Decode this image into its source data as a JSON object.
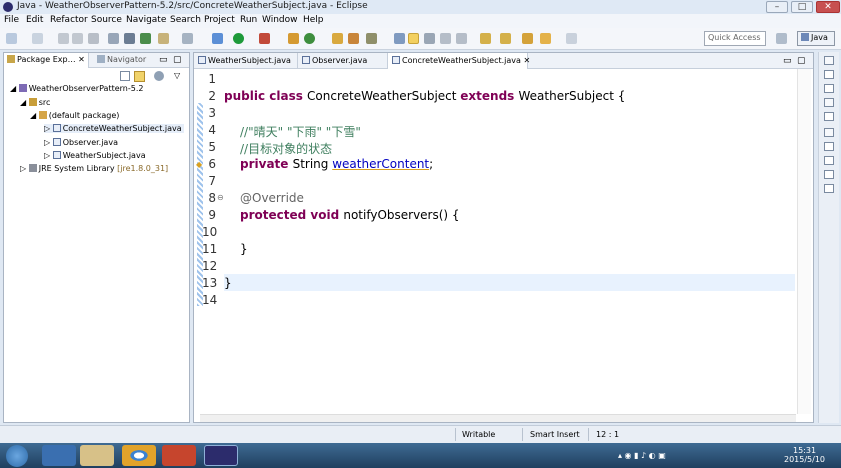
{
  "window": {
    "title": "Java - WeatherObserverPattern-5.2/src/ConcreteWeatherSubject.java - Eclipse",
    "minimize": "–",
    "maximize": "□",
    "close": "✕"
  },
  "menu": [
    "File",
    "Edit",
    "Refactor",
    "Source",
    "Navigate",
    "Search",
    "Project",
    "Run",
    "Window",
    "Help"
  ],
  "toolbar": {
    "quick_access_placeholder": "Quick Access",
    "perspective_label": "Java"
  },
  "package_explorer": {
    "tab_label": "Package Exp…",
    "navigator_label": "Navigator",
    "tree": [
      {
        "label": "WeatherObserverPattern-5.2",
        "indent": 0,
        "icon": "project-icon"
      },
      {
        "label": "src",
        "indent": 1,
        "icon": "source-folder-icon"
      },
      {
        "label": "(default package)",
        "indent": 2,
        "icon": "package-icon"
      },
      {
        "label": "ConcreteWeatherSubject.java",
        "indent": 3,
        "icon": "java-file-icon"
      },
      {
        "label": "Observer.java",
        "indent": 3,
        "icon": "java-file-icon"
      },
      {
        "label": "WeatherSubject.java",
        "indent": 3,
        "icon": "java-file-icon"
      },
      {
        "label": "JRE System Library",
        "suffix": "[jre1.8.0_31]",
        "indent": 1,
        "icon": "library-icon"
      }
    ]
  },
  "editor": {
    "tabs": [
      {
        "label": "WeatherSubject.java",
        "active": false
      },
      {
        "label": "Observer.java",
        "active": false
      },
      {
        "label": "ConcreteWeatherSubject.java",
        "active": true
      }
    ],
    "line_numbers": [
      "1",
      "2",
      "3",
      "4",
      "5",
      "6",
      "7",
      "8",
      "9",
      "10",
      "11",
      "12",
      "13",
      "14"
    ],
    "code": {
      "l2_kw": "public class ",
      "l2_name": "ConcreteWeatherSubject ",
      "l2_ext": "extends ",
      "l2_super": "WeatherSubject {",
      "l4": "//\"晴天\" \"下雨\" \"下雪\"",
      "l5": "//目标对象的状态",
      "l6_kw": "private ",
      "l6_type": "String ",
      "l6_field": "weatherContent",
      "l6_end": ";",
      "l8": "@Override",
      "l9_kw": "protected void ",
      "l9_rest": "notifyObservers() {",
      "l11": "}",
      "l13": "}"
    }
  },
  "status": {
    "writable": "Writable",
    "insert_mode": "Smart Insert",
    "position": "12 : 1"
  },
  "taskbar": {
    "clock_time": "15:31",
    "clock_date": "2015/5/10"
  },
  "colors": {
    "keyword": "#7f0055",
    "comment": "#3f7f5f",
    "field": "#0000c0",
    "annotation": "#646464"
  }
}
